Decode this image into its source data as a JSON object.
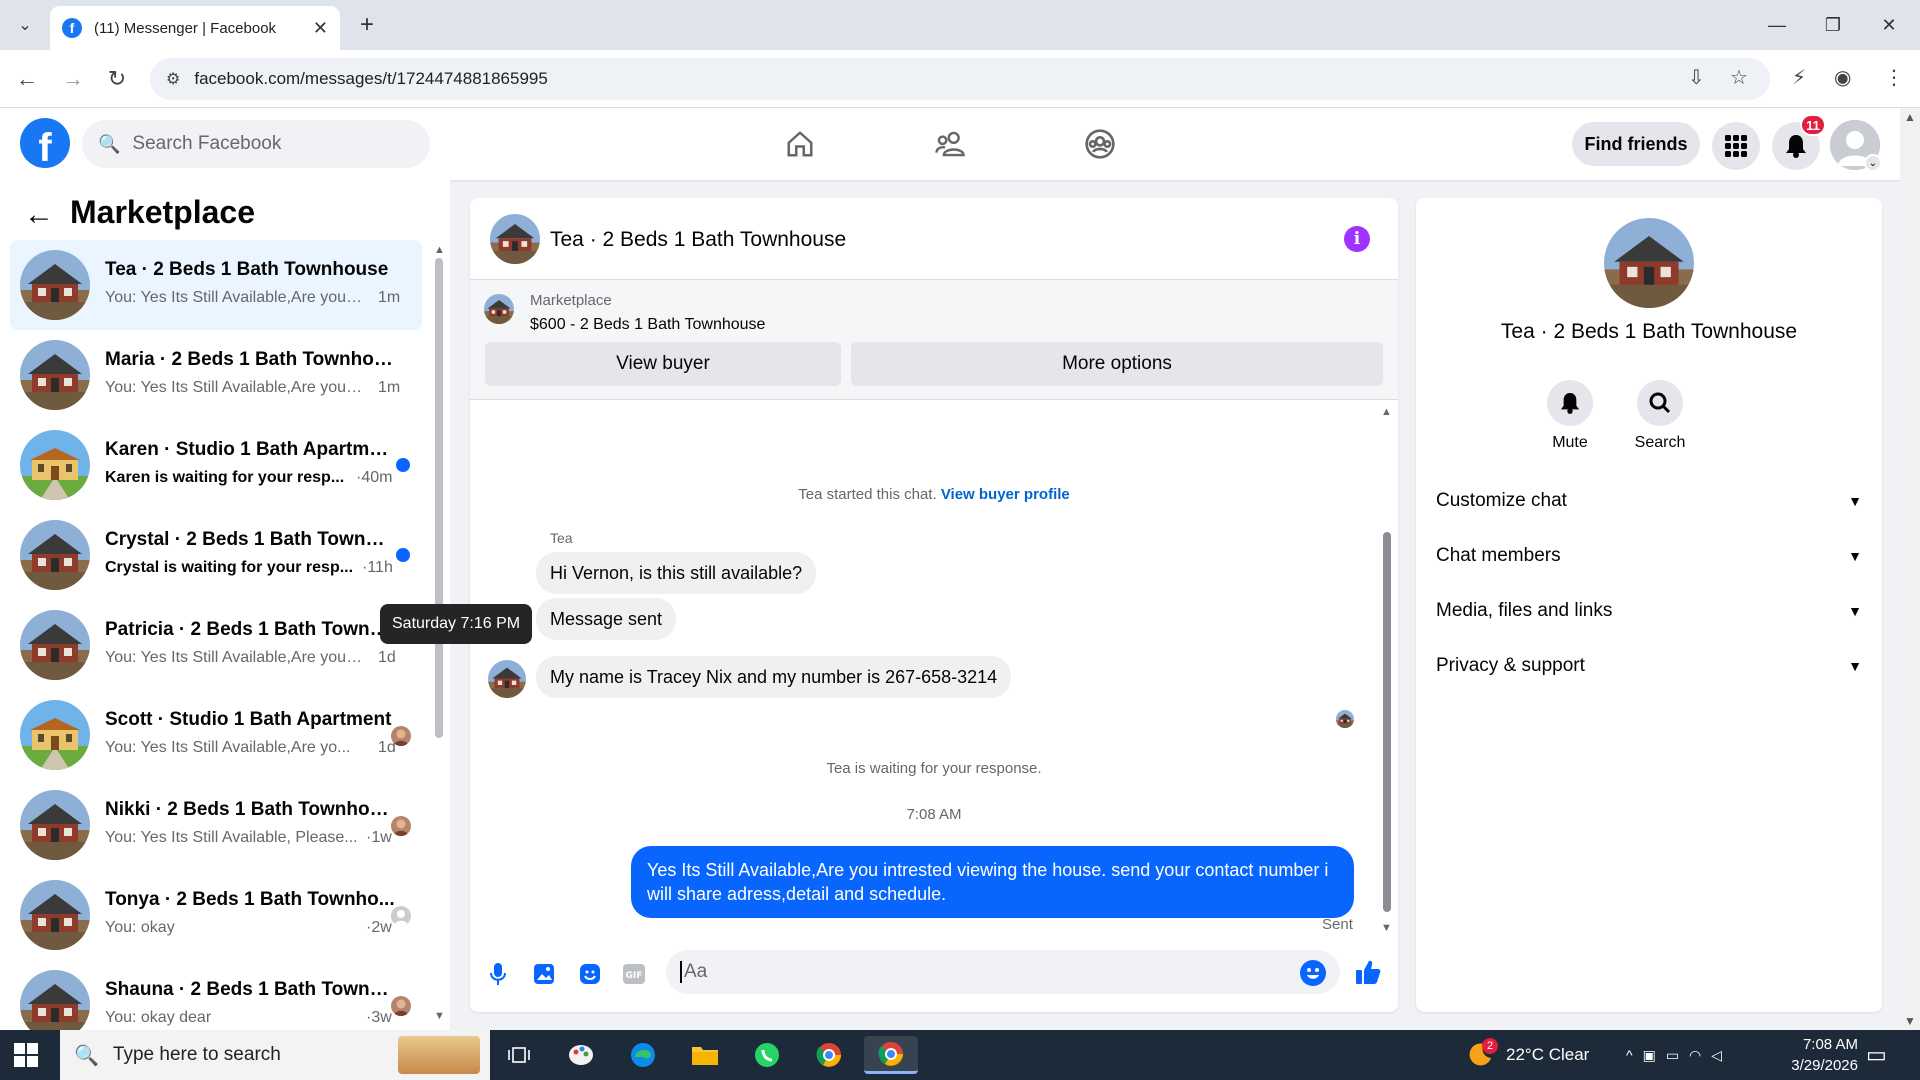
{
  "browser": {
    "tab_title": "(11) Messenger | Facebook",
    "url": "facebook.com/messages/t/1724474881865995"
  },
  "fb": {
    "search_placeholder": "Search Facebook",
    "find_friends": "Find friends",
    "notification_count": "11",
    "brand_color": "#1877f2"
  },
  "sidebar": {
    "title": "Marketplace",
    "conversations": [
      {
        "name": "Tea · 2 Beds 1 Bath Townhouse",
        "preview": "You: Yes Its Still Available,Are you i...",
        "time": "1m",
        "active": true,
        "unread": false,
        "thumb": "house"
      },
      {
        "name": "Maria · 2 Beds 1 Bath Townhouse",
        "preview": "You: Yes Its Still Available,Are you i...",
        "time": "1m",
        "active": false,
        "unread": false,
        "thumb": "house"
      },
      {
        "name": "Karen · Studio 1 Bath Apartment",
        "preview": "Karen is waiting for your resp...",
        "time": "·40m",
        "active": false,
        "unread": true,
        "thumb": "villa"
      },
      {
        "name": "Crystal · 2 Beds 1 Bath Townho...",
        "preview": "Crystal is waiting for your resp...",
        "time": "·11h",
        "active": false,
        "unread": true,
        "thumb": "house"
      },
      {
        "name": "Patricia · 2 Beds 1 Bath Townhou...",
        "preview": "You: Yes Its Still Available,Are you in...",
        "time": "1d",
        "active": false,
        "unread": false,
        "thumb": "house"
      },
      {
        "name": "Scott · Studio 1 Bath Apartment",
        "preview": "You: Yes Its Still Available,Are yo...",
        "time": "1d",
        "active": false,
        "unread": false,
        "thumb": "villa"
      },
      {
        "name": "Nikki · 2 Beds 1 Bath Townhou...",
        "preview": "You: Yes Its Still Available, Please...",
        "time": "·1w",
        "active": false,
        "unread": false,
        "thumb": "house"
      },
      {
        "name": "Tonya · 2 Beds 1 Bath Townho...",
        "preview": "You: okay",
        "time": "·2w",
        "active": false,
        "unread": false,
        "thumb": "house"
      },
      {
        "name": "Shauna · 2 Beds 1 Bath Townh...",
        "preview": "You: okay dear",
        "time": "·3w",
        "active": false,
        "unread": false,
        "thumb": "house"
      }
    ]
  },
  "tooltip": "Saturday 7:16 PM",
  "chat": {
    "title": "Tea · 2 Beds 1 Bath Townhouse",
    "marketplace_label": "Marketplace",
    "listing": "$600 - 2 Beds 1 Bath Townhouse",
    "view_buyer": "View buyer",
    "more_options": "More options",
    "started_text": "Tea started this chat.",
    "view_profile": "View buyer profile",
    "sender": "Tea",
    "msg1": "Hi Vernon, is this still available?",
    "msg2": "Message sent",
    "msg3": "My name is Tracey Nix and my number is 267-658-3214",
    "waiting": "Tea is waiting for your response.",
    "time_sep": "7:08 AM",
    "outgoing": "Yes Its Still Available,Are you intrested viewing the house. send your contact number i will share adress,detail and schedule.",
    "sent_label": "Sent",
    "composer_placeholder": "Aa",
    "accent": "#0866ff"
  },
  "details": {
    "name": "Tea · 2 Beds 1 Bath Townhouse",
    "mute": "Mute",
    "search": "Search",
    "sections": [
      "Customize chat",
      "Chat members",
      "Media, files and links",
      "Privacy & support"
    ]
  },
  "taskbar": {
    "search_placeholder": "Type here to search",
    "weather_badge": "2",
    "weather": "22°C  Clear",
    "time": "7:08 AM",
    "date": "3/29/2026"
  }
}
